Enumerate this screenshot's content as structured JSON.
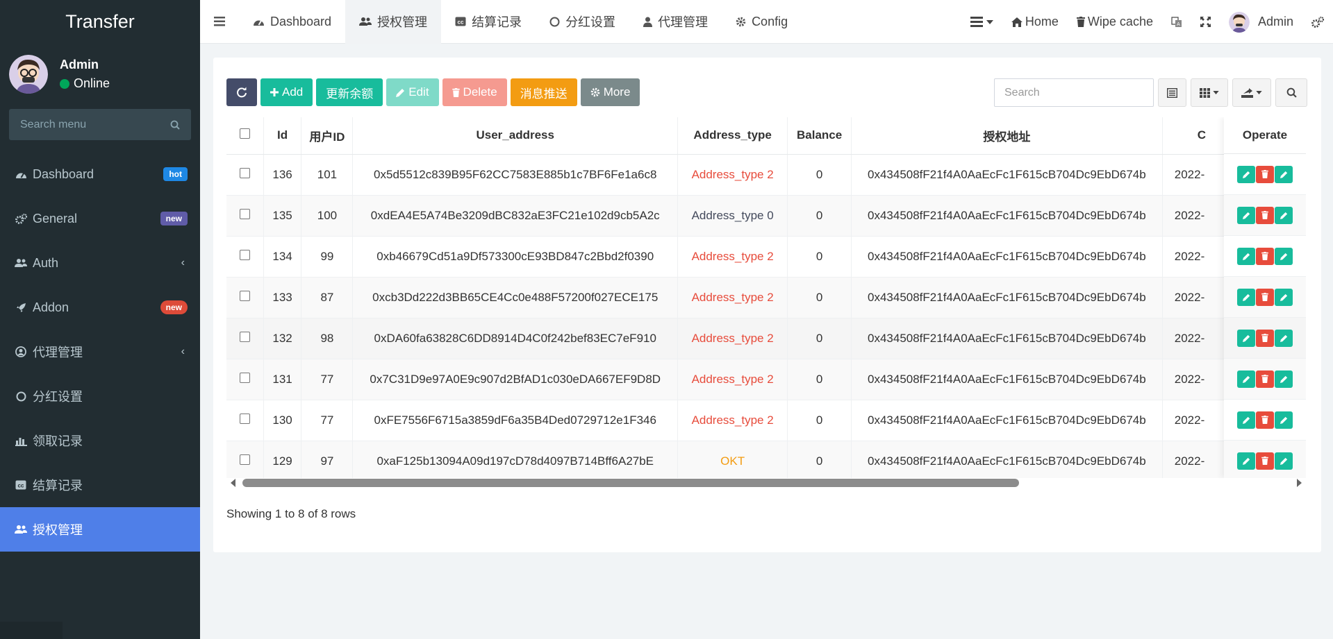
{
  "sidebar": {
    "brand": "Transfer",
    "user": {
      "name": "Admin",
      "status": "Online"
    },
    "search_placeholder": "Search menu",
    "items": [
      {
        "label": "Dashboard",
        "badge": "hot"
      },
      {
        "label": "General",
        "badge": "new"
      },
      {
        "label": "Auth"
      },
      {
        "label": "Addon",
        "badge": "new"
      },
      {
        "label": "代理管理"
      },
      {
        "label": "分红设置"
      },
      {
        "label": "领取记录"
      },
      {
        "label": "结算记录"
      },
      {
        "label": "授权管理"
      }
    ]
  },
  "navbar": {
    "tabs": [
      {
        "label": "Dashboard"
      },
      {
        "label": "授权管理"
      },
      {
        "label": "结算记录"
      },
      {
        "label": "分红设置"
      },
      {
        "label": "代理管理"
      },
      {
        "label": "Config"
      }
    ],
    "home": "Home",
    "wipe_cache": "Wipe cache",
    "user": "Admin"
  },
  "toolbar": {
    "add": "Add",
    "update_balance": "更新余额",
    "edit": "Edit",
    "delete": "Delete",
    "push": "消息推送",
    "more": "More",
    "search_placeholder": "Search"
  },
  "table": {
    "headers": {
      "id": "Id",
      "user_id": "用户ID",
      "user_address": "User_address",
      "address_type": "Address_type",
      "balance": "Balance",
      "auth_address": "授权地址",
      "created": "C",
      "operate": "Operate"
    },
    "rows": [
      {
        "id": "136",
        "user_id": "101",
        "user_address": "0x5d5512c839B95F62CC7583E885b1c7BF6Fe1a6c8",
        "address_type": "Address_type 2",
        "balance": "0",
        "auth_address": "0x434508fF21f4A0AaEcFc1F615cB704Dc9EbD674b",
        "created": "2022-"
      },
      {
        "id": "135",
        "user_id": "100",
        "user_address": "0xdEA4E5A74Be3209dBC832aE3FC21e102d9cb5A2c",
        "address_type": "Address_type 0",
        "balance": "0",
        "auth_address": "0x434508fF21f4A0AaEcFc1F615cB704Dc9EbD674b",
        "created": "2022-"
      },
      {
        "id": "134",
        "user_id": "99",
        "user_address": "0xb46679Cd51a9Df573300cE93BD847c2Bbd2f0390",
        "address_type": "Address_type 2",
        "balance": "0",
        "auth_address": "0x434508fF21f4A0AaEcFc1F615cB704Dc9EbD674b",
        "created": "2022-"
      },
      {
        "id": "133",
        "user_id": "87",
        "user_address": "0xcb3Dd222d3BB65CE4Cc0e488F57200f027ECE175",
        "address_type": "Address_type 2",
        "balance": "0",
        "auth_address": "0x434508fF21f4A0AaEcFc1F615cB704Dc9EbD674b",
        "created": "2022-"
      },
      {
        "id": "132",
        "user_id": "98",
        "user_address": "0xDA60fa63828C6DD8914D4C0f242bef83EC7eF910",
        "address_type": "Address_type 2",
        "balance": "0",
        "auth_address": "0x434508fF21f4A0AaEcFc1F615cB704Dc9EbD674b",
        "created": "2022-"
      },
      {
        "id": "131",
        "user_id": "77",
        "user_address": "0x7C31D9e97A0E9c907d2BfAD1c030eDA667EF9D8D",
        "address_type": "Address_type 2",
        "balance": "0",
        "auth_address": "0x434508fF21f4A0AaEcFc1F615cB704Dc9EbD674b",
        "created": "2022-"
      },
      {
        "id": "130",
        "user_id": "77",
        "user_address": "0xFE7556F6715a3859dF6a35B4Ded0729712e1F346",
        "address_type": "Address_type 2",
        "balance": "0",
        "auth_address": "0x434508fF21f4A0AaEcFc1F615cB704Dc9EbD674b",
        "created": "2022-"
      },
      {
        "id": "129",
        "user_id": "97",
        "user_address": "0xaF125b13094A09d197cD78d4097B714Bff6A27bE",
        "address_type": "OKT",
        "balance": "0",
        "auth_address": "0x434508fF21f4A0AaEcFc1F615cB704Dc9EbD674b",
        "created": "2022-"
      }
    ]
  },
  "pager": {
    "text": "Showing 1 to 8 of 8 rows"
  },
  "colors": {
    "sidebar_bg": "#222d32",
    "active_item": "#4f7fe8",
    "success": "#18bc9c",
    "danger": "#e74c3c",
    "warning": "#f39c12"
  }
}
